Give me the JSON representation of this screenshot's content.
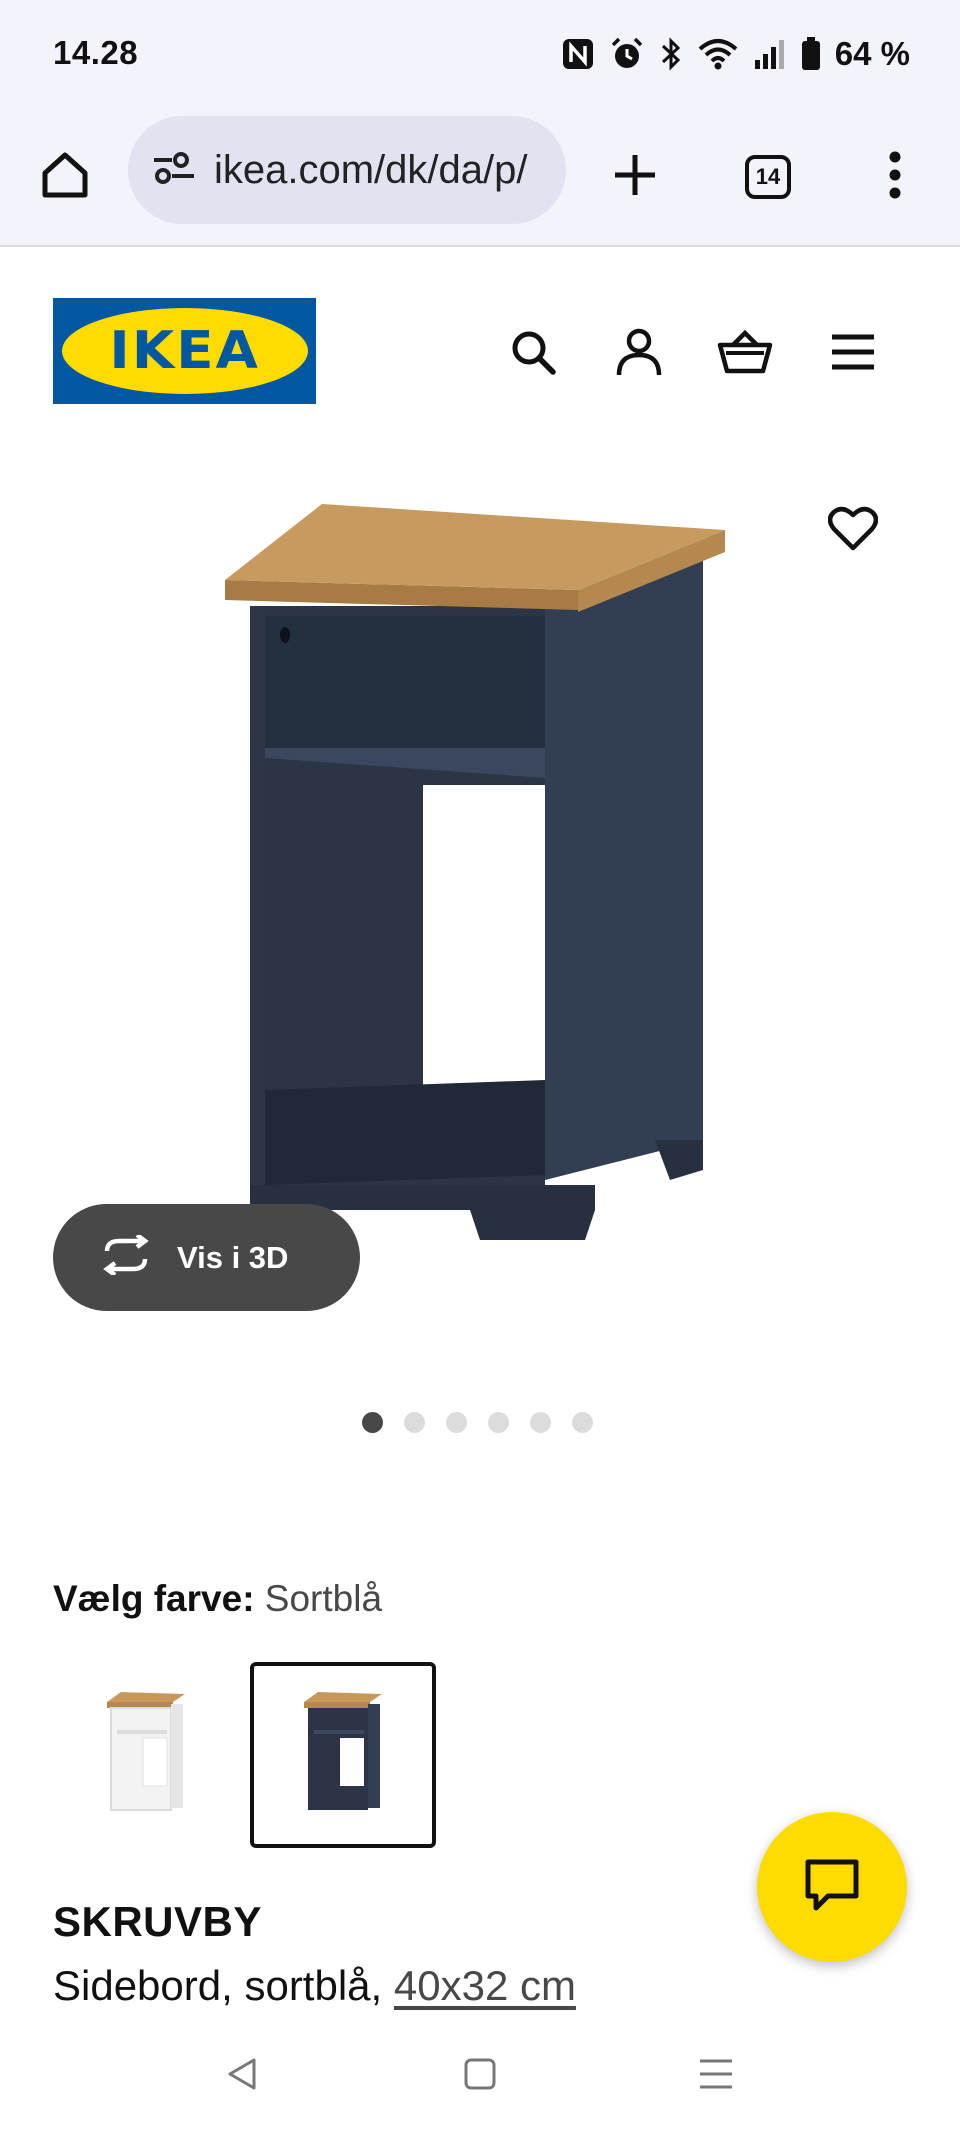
{
  "status_bar": {
    "time": "14.28",
    "battery": "64 %"
  },
  "browser": {
    "url": "ikea.com/dk/da/p/",
    "tab_count": "14"
  },
  "ikea": {
    "logo_text": "IKEA",
    "brand_colors": {
      "blue": "#0058a3",
      "yellow": "#ffdb00"
    }
  },
  "product": {
    "view_3d_label": "Vis i 3D",
    "carousel": {
      "total": 6,
      "active_index": 0
    },
    "color_label": "Vælg farve:",
    "color_value": "Sortblå",
    "swatches": [
      {
        "name": "white",
        "selected": false
      },
      {
        "name": "sortblå",
        "selected": true
      }
    ],
    "name": "SKRUVBY",
    "description": "Sidebord, sortblå,",
    "size": "40x32 cm"
  },
  "icons": {
    "home": "home-icon",
    "site_settings": "site-settings-icon",
    "plus": "plus-icon",
    "more": "more-vert-icon",
    "search": "search-icon",
    "account": "account-icon",
    "cart": "shopping-basket-icon",
    "menu": "hamburger-menu-icon",
    "wishlist": "heart-icon",
    "rotate": "rotate-3d-icon",
    "chat": "chat-icon"
  }
}
